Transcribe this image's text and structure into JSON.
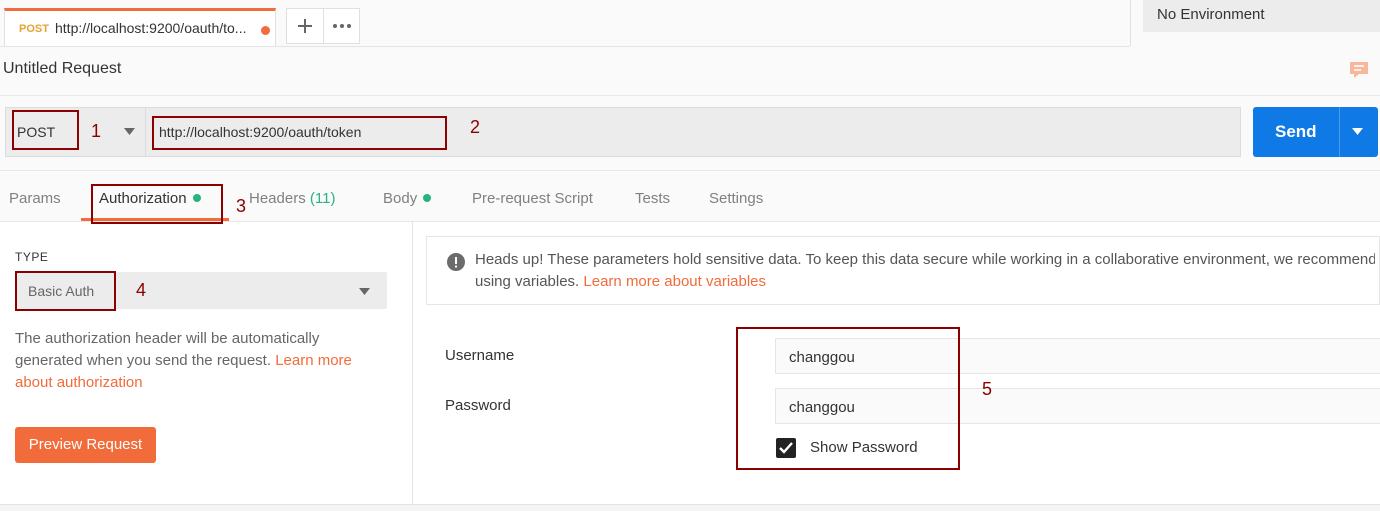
{
  "request_tab": {
    "method": "POST",
    "name": "http://localhost:9200/oauth/to..."
  },
  "environment": "No Environment",
  "request_title": "Untitled Request",
  "url_bar": {
    "method": "POST",
    "url": "http://localhost:9200/oauth/token",
    "send_label": "Send"
  },
  "tabs": {
    "params": "Params",
    "authorization": "Authorization",
    "headers": "Headers",
    "headers_count": "(11)",
    "body": "Body",
    "prerequest": "Pre-request Script",
    "tests": "Tests",
    "settings": "Settings"
  },
  "auth": {
    "type_label": "TYPE",
    "type_value": "Basic Auth",
    "description": "The authorization header will be automatically generated when you send the request. ",
    "learn_more": "Learn more about authorization",
    "preview_button": "Preview Request"
  },
  "notice": {
    "text": "Heads up! These parameters hold sensitive data. To keep this data secure while working in a collaborative environment, we recommend",
    "text2": "using variables. ",
    "link": "Learn more about variables"
  },
  "fields": {
    "username_label": "Username",
    "username_value": "changgou",
    "password_label": "Password",
    "password_value": "changgou",
    "show_password_label": "Show Password",
    "show_password_checked": true
  },
  "annotations": [
    "1",
    "2",
    "3",
    "4",
    "5"
  ],
  "colors": {
    "accent": "#f26b3a",
    "send_blue": "#0f7ae5",
    "green_dot": "#26b47f",
    "annotation": "#8b0000"
  }
}
